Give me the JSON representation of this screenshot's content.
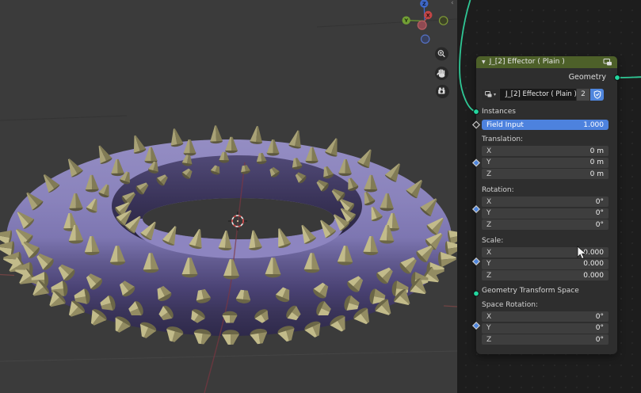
{
  "viewport": {
    "gizmo_axes": {
      "x": "X",
      "y": "Y",
      "z": "Z"
    },
    "colors": {
      "background": "#3b3b3b",
      "torus_top": "#8f88c1",
      "torus_dark": "#363057",
      "cone_light": "#c2bb8a",
      "cone_dark": "#6b6647",
      "axis_red": "#7c3642"
    }
  },
  "node_editor": {
    "background": "#1d1d1d",
    "wire_color": "#2fc795",
    "socket_color": "#23d79f",
    "node": {
      "title": "J_[2] Effector ( Plain )",
      "header_color": "#4d6029",
      "output_label": "Geometry",
      "datablock": {
        "name": "J_[2] Effector ( Plain )",
        "users": "2"
      },
      "instances_label": "Instances",
      "field_input": {
        "label": "Field Input",
        "value": "1.000"
      },
      "translation": {
        "label": "Translation:",
        "rows": [
          {
            "axis": "X",
            "value": "0 m"
          },
          {
            "axis": "Y",
            "value": "0 m"
          },
          {
            "axis": "Z",
            "value": "0 m"
          }
        ]
      },
      "rotation": {
        "label": "Rotation:",
        "rows": [
          {
            "axis": "X",
            "value": "0°"
          },
          {
            "axis": "Y",
            "value": "0°"
          },
          {
            "axis": "Z",
            "value": "0°"
          }
        ]
      },
      "scale": {
        "label": "Scale:",
        "rows": [
          {
            "axis": "X",
            "value": "0.000"
          },
          {
            "axis": "Y",
            "value": "0.000"
          },
          {
            "axis": "Z",
            "value": "0.000"
          }
        ]
      },
      "transform_space_label": "Geometry Transform Space",
      "space_rotation": {
        "label": "Space Rotation:",
        "rows": [
          {
            "axis": "X",
            "value": "0°"
          },
          {
            "axis": "Y",
            "value": "0°"
          },
          {
            "axis": "Z",
            "value": "0°"
          }
        ]
      }
    }
  }
}
